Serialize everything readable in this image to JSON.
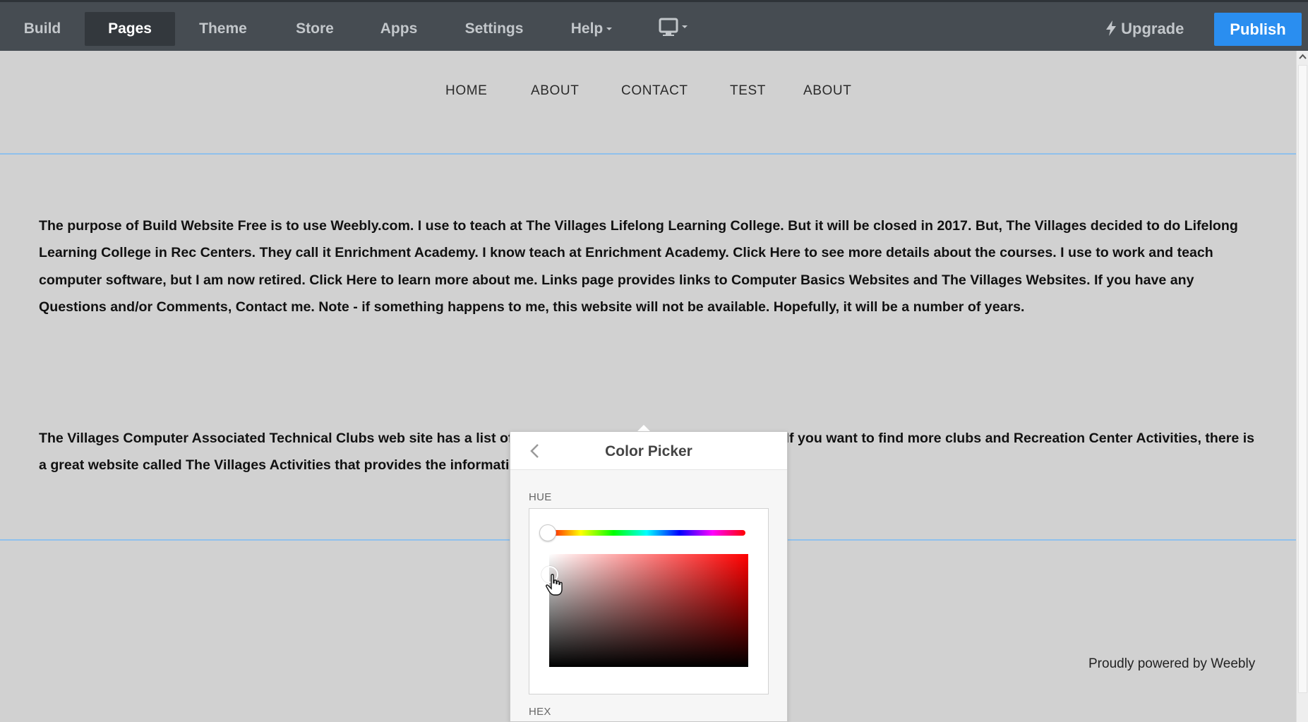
{
  "toolbar": {
    "items": [
      {
        "label": "Build"
      },
      {
        "label": "Pages"
      },
      {
        "label": "Theme"
      },
      {
        "label": "Store"
      },
      {
        "label": "Apps"
      },
      {
        "label": "Settings"
      },
      {
        "label": "Help"
      }
    ],
    "active": "Pages",
    "device_icon": "desktop-monitor-icon",
    "upgrade_label": "Upgrade",
    "upgrade_icon": "lightning-bolt-icon",
    "publish_label": "Publish",
    "publish_color": "#2a8ef0"
  },
  "site": {
    "nav": [
      "HOME",
      "ABOUT",
      "CONTACT",
      "TEST",
      "ABOUT"
    ],
    "paragraph1": "The purpose of Build Website Free is to use Weebly.com.  I use to teach at The Villages Lifelong Learning College. But it will be closed in 2017.  But, The Villages decided to do Lifelong Learning College in Rec Centers.  They call it Enrichment Academy. I know teach at Enrichment Academy.  Click Here to see more details about the courses.  I use to work and teach computer software, but I am now retired.  Click Here to learn more about me.  Links page provides links to Computer Basics Websites and The Villages Websites.  If you have any Questions and/or Comments, Contact me. Note - if something happens to me, this website will not be available.  Hopefully, it will be a number of years.",
    "paragraph2": "The Villages Computer  Associated Technical Clubs web site has a list of Computer Clubs and a link to Tech Help.  If you want to find more clubs and Recreation Center Activities, there is a great website called The Villages Activities that provides the information.",
    "footer": "Proudly powered by Weebly",
    "divider_color": "#8fc0ec"
  },
  "color_picker": {
    "title": "Color Picker",
    "back_icon": "chevron-left-icon",
    "hue_label": "HUE",
    "hex_label": "HEX",
    "selected_hue": "#ff0000"
  }
}
